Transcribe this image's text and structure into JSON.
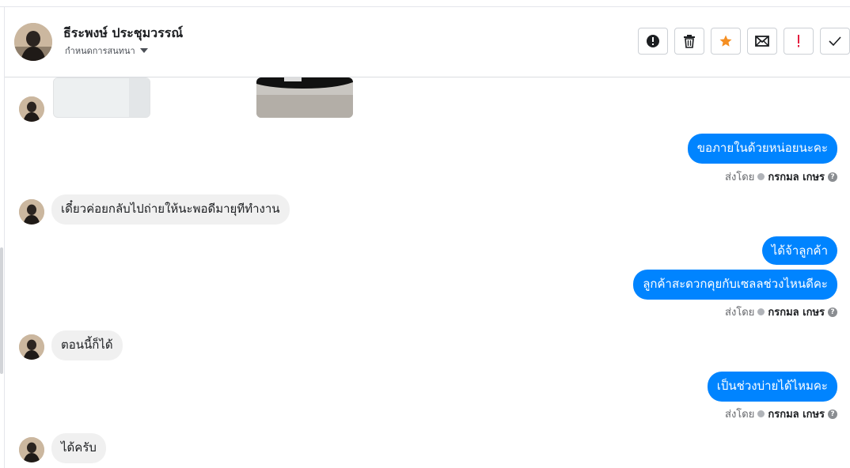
{
  "header": {
    "contact_name": "ธีระพงษ์ ประชุมวรรณ์",
    "subtitle": "กำหนดการสนทนา"
  },
  "toolbar": {
    "buttons": [
      {
        "icon": "alert-circle-icon",
        "color": "#1c1e21"
      },
      {
        "icon": "trash-icon",
        "color": "#1c1e21"
      },
      {
        "icon": "star-icon",
        "color": "#f58f22"
      },
      {
        "icon": "envelope-icon",
        "color": "#1c1e21"
      },
      {
        "icon": "exclamation-icon",
        "color": "#e41e3f"
      },
      {
        "icon": "check-icon",
        "color": "#1c1e21"
      }
    ]
  },
  "messages": {
    "out_1": "ขอภายในด้วยหน่อยนะคะ",
    "in_1": "เดี๋ยวค่อยกลับไปถ่ายให้นะพอดีมายุทีทำงาน",
    "out_2": "ได้จ้าลูกค้า",
    "out_3": "ลูกค้าสะดวกคุยกับเซลลช่วงไหนดีคะ",
    "in_2": "ตอนนี้ก็ได้",
    "out_4": "เป็นช่วงบ่ายได้ไหมคะ",
    "in_3": "ได้ครับ"
  },
  "sent_by": {
    "prefix": "ส่งโดย",
    "agent": "กรกมล เกษร"
  },
  "colors": {
    "outgoing_bubble": "#0084ff",
    "incoming_bubble": "#f0f0f0"
  }
}
